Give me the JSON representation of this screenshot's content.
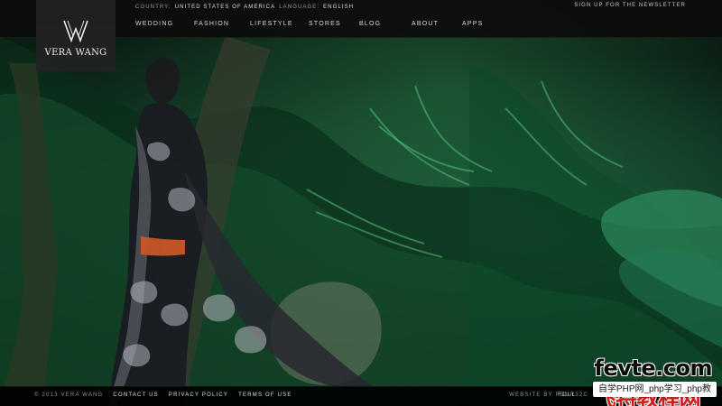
{
  "brand": {
    "logo_text": "VERA WANG",
    "logo_icon": "vw-monogram-icon",
    "colors": {
      "topbar_bg": "#0c0c0c",
      "logo_box_bg": "#232323",
      "footer_bg": "#000000",
      "text_primary": "#ededed"
    }
  },
  "header": {
    "utility": {
      "country_label": "COUNTRY:",
      "country_value": "UNITED STATES OF AMERICA",
      "language_label": "LANGUAGE:",
      "language_value": "ENGLISH",
      "newsletter_label": "SIGN UP FOR THE NEWSLETTER"
    },
    "nav": [
      {
        "label": "WEDDING"
      },
      {
        "label": "FASHION"
      },
      {
        "label": "LIFESTYLE"
      },
      {
        "label": "STORES"
      },
      {
        "label": "BLOG"
      },
      {
        "label": "ABOUT"
      },
      {
        "label": "APPS"
      }
    ]
  },
  "hero": {
    "image_semantic": "model-in-jungle-photo"
  },
  "footer": {
    "copyright": "© 2013 VERA WANG",
    "links": [
      {
        "label": "CONTACT US"
      },
      {
        "label": "PRIVACY POLICY"
      },
      {
        "label": "TERMS OF USE"
      }
    ],
    "credit": "WEBSITE BY FOUR32C",
    "follow_label": "FOLL"
  },
  "watermark": {
    "top_text_main": "fevte.com",
    "top_text_accent": "飞特教程网",
    "bottom_text": "自学PHP网_php学习_php教"
  }
}
